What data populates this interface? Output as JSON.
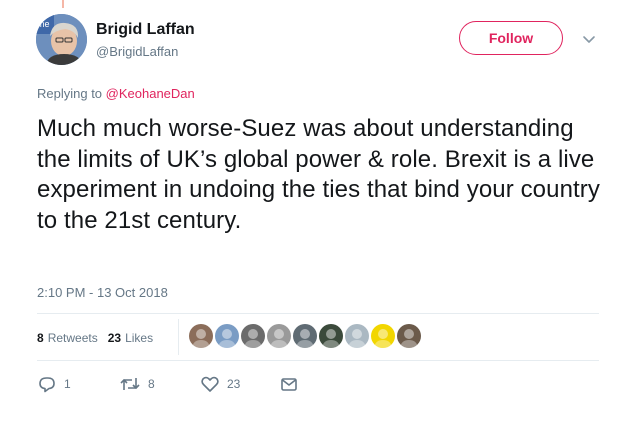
{
  "tweet": {
    "author": {
      "name": "Brigid Laffan",
      "handle": "@BrigidLaffan"
    },
    "follow_label": "Follow",
    "replying_prefix": "Replying to ",
    "replying_mention": "@KeohaneDan",
    "text": "Much much worse-Suez was about understanding the limits of UK’s global power & role. Brexit is a live experiment in undoing the ties that bind your country to the 21st century.",
    "timestamp": "2:10 PM - 13 Oct 2018"
  },
  "stats": {
    "retweets_count": "8",
    "retweets_label": "Retweets",
    "likes_count": "23",
    "likes_label": "Likes",
    "likers": [
      {
        "icon": "avatar-1",
        "color": "#8b6d5a"
      },
      {
        "icon": "avatar-2",
        "color": "#7a9cc4"
      },
      {
        "icon": "avatar-3",
        "color": "#6b6b6b"
      },
      {
        "icon": "avatar-4",
        "color": "#9a9a9a"
      },
      {
        "icon": "avatar-5",
        "color": "#5f6b73"
      },
      {
        "icon": "avatar-6",
        "color": "#3b4a3b"
      },
      {
        "icon": "avatar-default",
        "color": "#aab8c2"
      },
      {
        "icon": "avatar-8",
        "color": "#f2d600"
      },
      {
        "icon": "avatar-9",
        "color": "#6b5a4a"
      }
    ]
  },
  "actions": {
    "reply_count": "1",
    "retweet_count": "8",
    "like_count": "23"
  },
  "colors": {
    "accent": "#e0245e",
    "muted": "#657786",
    "divider": "#e6ecf0"
  }
}
